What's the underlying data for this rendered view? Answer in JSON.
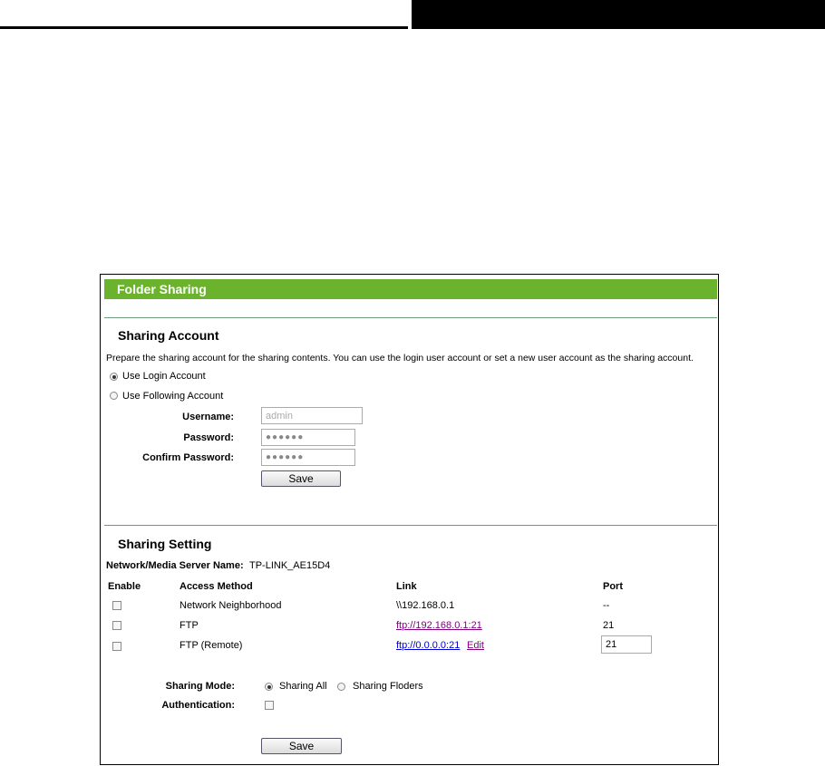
{
  "panel": {
    "title": "Folder Sharing"
  },
  "account": {
    "section_title": "Sharing Account",
    "description": "Prepare the sharing account for the sharing contents. You can use the login user account or set a new user account as the sharing account.",
    "option_login": "Use Login Account",
    "option_following": "Use Following Account",
    "username_label": "Username:",
    "username_value": "admin",
    "password_label": "Password:",
    "password_value": "●●●●●●",
    "confirm_label": "Confirm Password:",
    "confirm_value": "●●●●●●",
    "save_label": "Save"
  },
  "setting": {
    "section_title": "Sharing Setting",
    "server_name_label": "Network/Media Server Name:",
    "server_name_value": "TP-LINK_AE15D4",
    "columns": {
      "enable": "Enable",
      "method": "Access Method",
      "link": "Link",
      "port": "Port"
    },
    "rows": [
      {
        "method": "Network Neighborhood",
        "link": "\\\\192.168.0.1",
        "port": "--"
      },
      {
        "method": "FTP",
        "link": "ftp://192.168.0.1:21",
        "port": "21"
      },
      {
        "method": "FTP (Remote)",
        "link": "ftp://0.0.0.0:21",
        "edit": "Edit",
        "port": "21"
      }
    ],
    "sharing_mode_label": "Sharing Mode:",
    "mode_all": "Sharing All",
    "mode_folders": "Sharing Floders",
    "auth_label": "Authentication:",
    "save_label": "Save"
  }
}
